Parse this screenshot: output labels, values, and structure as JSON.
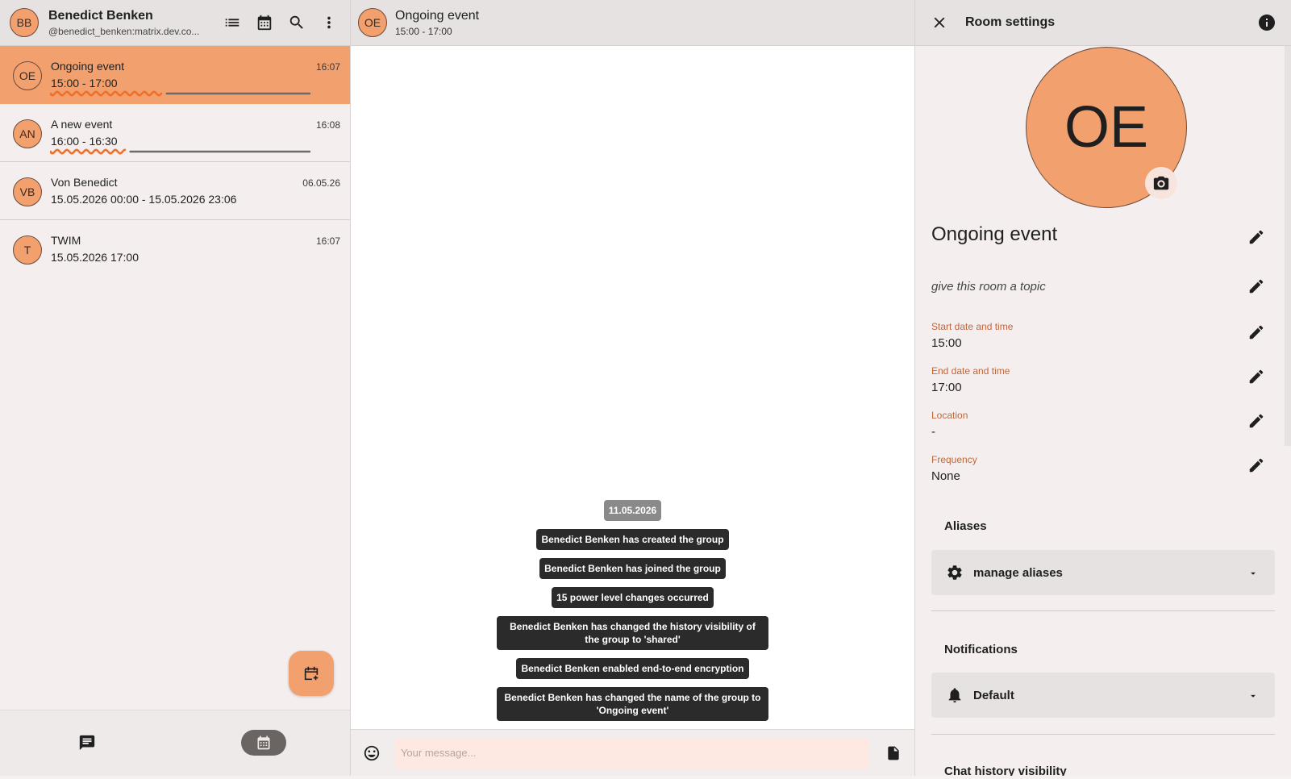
{
  "left": {
    "user": {
      "initials": "BB",
      "name": "Benedict Benken",
      "id": "@benedict_benken:matrix.dev.co..."
    },
    "header_icons": [
      "list-icon",
      "calendar-icon",
      "search-icon",
      "more-vert-icon"
    ],
    "rooms": [
      {
        "initials": "OE",
        "name": "Ongoing event",
        "sub": "15:00 - 17:00",
        "time": "16:07",
        "active": true,
        "progress": 0.43
      },
      {
        "initials": "AN",
        "name": "A new event",
        "sub": "16:00 - 16:30",
        "time": "16:08",
        "active": false,
        "progress": 0.29
      },
      {
        "initials": "VB",
        "name": "Von Benedict",
        "sub": "15.05.2026 00:00 - 15.05.2026 23:06",
        "time": "06.05.26",
        "active": false
      },
      {
        "initials": "T",
        "name": "TWIM",
        "sub": "15.05.2026 17:00",
        "time": "16:07",
        "active": false
      }
    ],
    "fab_icon": "calendar-add-icon",
    "bottom_nav": [
      {
        "icon": "chat-icon",
        "selected": false
      },
      {
        "icon": "calendar-icon",
        "selected": true
      }
    ]
  },
  "middle": {
    "room": {
      "initials": "OE",
      "name": "Ongoing event",
      "time": "15:00 - 17:00"
    },
    "date": "11.05.2026",
    "events": [
      "Benedict Benken has created the group",
      "Benedict Benken has joined the group",
      "15 power level changes occurred",
      "Benedict Benken has changed the history visibility of the group to 'shared'",
      "Benedict Benken enabled end-to-end encryption",
      "Benedict Benken has changed the name of the group to 'Ongoing event'"
    ],
    "composer": {
      "placeholder": "Your message..."
    }
  },
  "right": {
    "title": "Room settings",
    "avatar_initials": "OE",
    "room_name": "Ongoing event",
    "topic_placeholder": "give this room a topic",
    "fields": [
      {
        "label": "Start date and time",
        "value": "15:00"
      },
      {
        "label": "End date and time",
        "value": "17:00"
      },
      {
        "label": "Location",
        "value": "-"
      },
      {
        "label": "Frequency",
        "value": "None"
      }
    ],
    "aliases": {
      "section": "Aliases",
      "dropdown": "manage aliases"
    },
    "notifications": {
      "section": "Notifications",
      "dropdown": "Default"
    },
    "chat_history": {
      "section": "Chat history visibility"
    }
  },
  "colors": {
    "accent": "#f2a06e",
    "label": "#c0653a",
    "wave": "#f0702a"
  }
}
